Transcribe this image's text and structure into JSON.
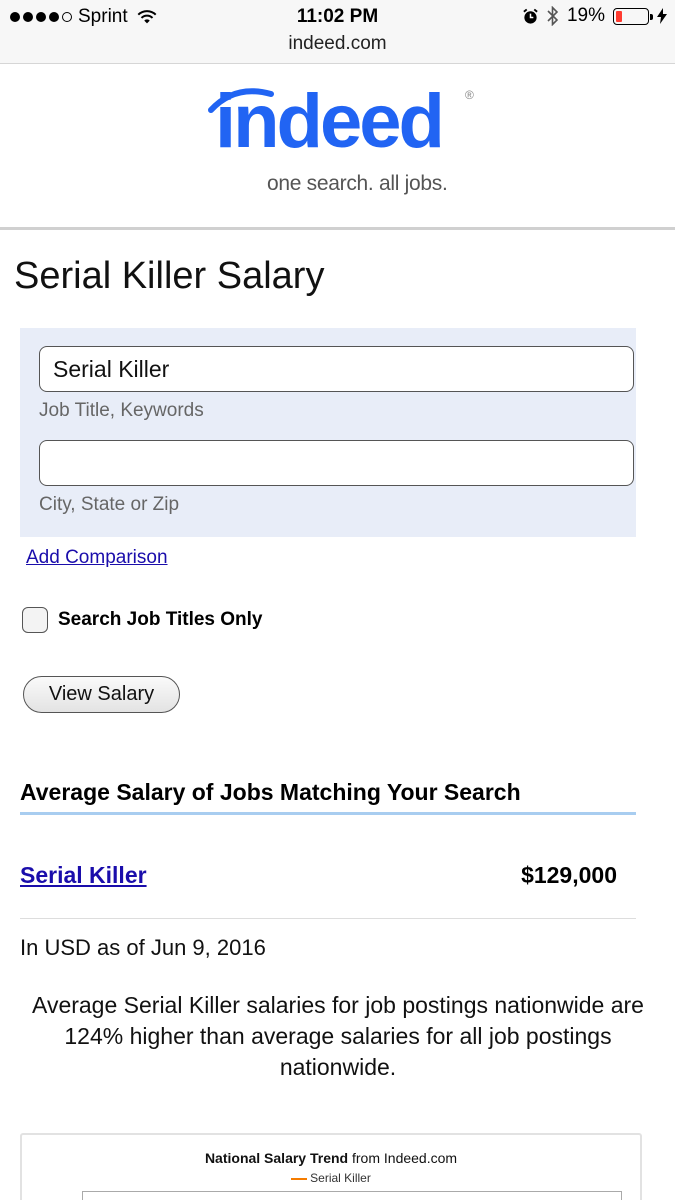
{
  "status_bar": {
    "carrier": "Sprint",
    "time": "11:02 PM",
    "battery_percent": "19%",
    "battery_level": 0.19,
    "icons": [
      "signal-dots-icon",
      "wifi-icon",
      "alarm-icon",
      "bluetooth-icon",
      "battery-icon",
      "charging-bolt-icon"
    ]
  },
  "browser": {
    "url": "indeed.com"
  },
  "logo": {
    "wordmark": "indeed",
    "registered": "®",
    "tagline": "one search. all jobs.",
    "brand_color": "#2164f3"
  },
  "page_title": "Serial Killer Salary",
  "search": {
    "job_title_value": "Serial Killer",
    "job_title_hint": "Job Title, Keywords",
    "location_value": "",
    "location_hint": "City, State or Zip",
    "add_comparison": "Add Comparison",
    "titles_only_label": "Search Job Titles Only",
    "titles_only_checked": false,
    "submit_label": "View Salary"
  },
  "results": {
    "heading": "Average Salary of Jobs Matching Your Search",
    "rows": [
      {
        "title": "Serial Killer",
        "salary": "$129,000"
      }
    ],
    "as_of_note": "In USD as of Jun 9, 2016",
    "summary": "Average Serial Killer salaries for job postings nationwide are 124% higher than average salaries for all job postings nationwide."
  },
  "chart": {
    "title_bold": "National Salary Trend",
    "title_rest": " from Indeed.com",
    "legend": "Serial Killer",
    "series_color": "#f57c00"
  }
}
